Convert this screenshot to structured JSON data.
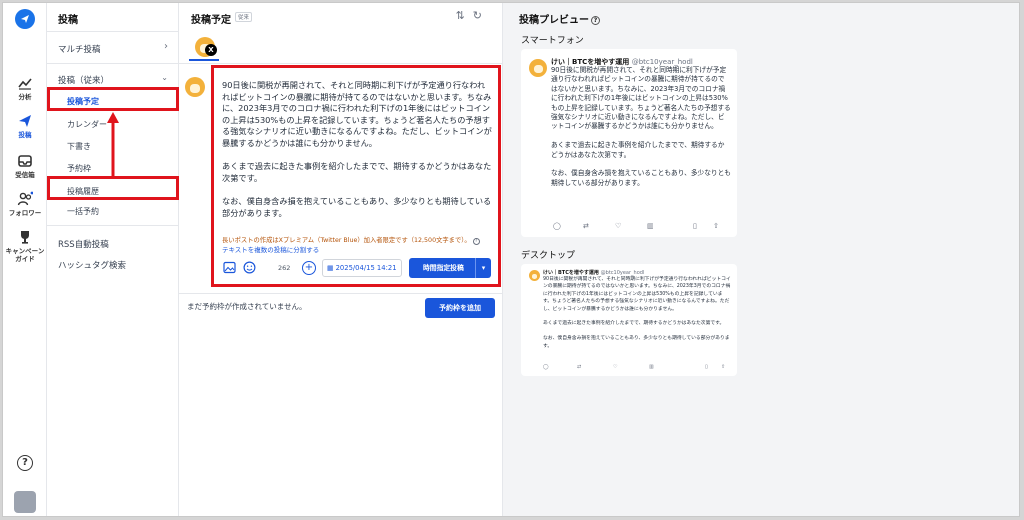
{
  "rail": {
    "items": [
      {
        "label": "分析"
      },
      {
        "label": "投稿"
      },
      {
        "label": "受信箱"
      },
      {
        "label": "フォロワー"
      },
      {
        "label": "キャンペーン\nガイド"
      }
    ]
  },
  "menu": {
    "title": "投稿",
    "multi": "マルチ投稿",
    "legacy": "投稿（従来）",
    "subs": [
      "投稿予定",
      "カレンダー",
      "下書き",
      "予約枠",
      "投稿履歴",
      "一括予約"
    ],
    "rss": "RSS自動投稿",
    "hashtag": "ハッシュタグ検索"
  },
  "center": {
    "title": "投稿予定",
    "badge": "従来",
    "post_text": "90日後に関税が再開されて、それと同時期に利下げが予定通り行なわれればビットコインの暴騰に期待が持てるのではないかと思います。ちなみに、2023年3月でのコロナ禍に行われた利下げの1年後にはビットコインの上昇は530%もの上昇を記録しています。ちょうど著名人たちの予想する強気なシナリオに近い動きになるんですよね。ただし、ビットコインが暴騰するかどうかは誰にも分かりません。\n\nあくまで過去に起きた事例を紹介したまでで、期待するかどうかはあなた次第です。\n\nなお、僕自身含み損を抱えていることもあり、多少なりとも期待している部分があります。",
    "warning": "長いポストの作成はXプレミアム（Twitter Blue）加入者限定です（12,500文字まで）。",
    "split_link": "テキストを複数の投稿に分割する",
    "char_count": "262",
    "date": "2025/04/15 14:21",
    "schedule_button": "時間指定投稿",
    "no_slot": "まだ予約枠が作成されていません。",
    "add_slot_button": "予約枠を追加"
  },
  "preview": {
    "title": "投稿プレビュー",
    "smartphone": "スマートフォン",
    "desktop": "デスクトップ",
    "account_name": "けい｜BTCを増やす運用",
    "handle": "@btc10year_hodl",
    "text": "90日後に関税が再開されて、それと同時期に利下げが予定通り行なわれればビットコインの暴騰に期待が持てるのではないかと思います。ちなみに、2023年3月でのコロナ禍に行われた利下げの1年後にはビットコインの上昇は530%もの上昇を記録しています。ちょうど著名人たちの予想する強気なシナリオに近い動きになるんですよね。ただし、ビットコインが暴騰するかどうかは誰にも分かりません。\n\nあくまで過去に起きた事例を紹介したまでで、期待するかどうかはあなた次第です。\n\nなお、僕自身含み損を抱えていることもあり、多少なりとも期待している部分があります。"
  },
  "colors": {
    "accent": "#1a56db",
    "highlight": "#e0141c"
  }
}
